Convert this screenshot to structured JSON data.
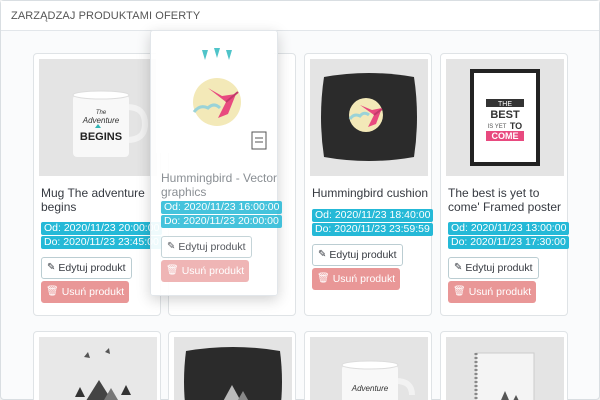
{
  "panel": {
    "title": "ZARZĄDZAJ PRODUKTAMI OFERTY"
  },
  "products": [
    {
      "name": "Mug The adventure begins",
      "from": "Od: 2020/11/23 20:00:00",
      "to": "Do: 2020/11/23 23:45:00",
      "edit_label": "Edytuj produkt",
      "delete_label": "Usuń produkt"
    },
    {
      "name": "Hummingbird - Vector graphics",
      "from": "Od: 2020/11/23 16:00:00",
      "to": "Do: 2020/11/23 20:00:00",
      "edit_label": "Edytuj produkt",
      "delete_label": "Usuń produkt"
    },
    {
      "name": "Hummingbird cushion",
      "from": "Od: 2020/11/23 18:40:00",
      "to": "Do: 2020/11/23 23:59:59",
      "edit_label": "Edytuj produkt",
      "delete_label": "Usuń produkt"
    },
    {
      "name": "The best is yet to come' Framed poster",
      "from": "Od: 2020/11/23 13:00:00",
      "to": "Do: 2020/11/23 17:30:00",
      "edit_label": "Edytuj produkt",
      "delete_label": "Usuń produkt"
    }
  ],
  "images": {
    "mug_text_1": "The",
    "mug_text_2": "Adventure",
    "mug_text_3": "BEGINS",
    "poster_text_1": "THE",
    "poster_text_2": "BEST",
    "poster_text_3": "IS YET",
    "poster_text_4": "TO",
    "poster_text_5": "COME",
    "bottom_mug_text": "Adventure"
  },
  "icons": {
    "edit": "pencil-icon",
    "delete": "trash-icon"
  },
  "colors": {
    "date_badge": "#25b9d7",
    "delete_button": "#e99797",
    "accent": "#e84a7f"
  }
}
